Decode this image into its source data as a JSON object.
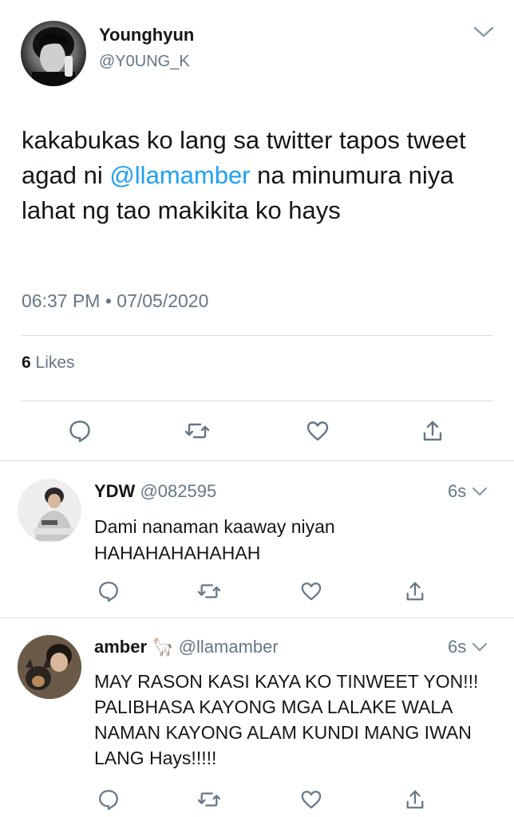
{
  "tweet": {
    "name": "Younghyun",
    "handle": "@Y0UNG_K",
    "text_before": "kakabukas ko lang sa twitter tapos tweet agad ni ",
    "mention": "@llamamber",
    "text_after": " na minumura niya lahat ng tao makikita ko hays",
    "timestamp": "06:37 PM • 07/05/2020",
    "likes_count": "6",
    "likes_label": "Likes"
  },
  "replies": [
    {
      "name": "YDW",
      "emoji": "",
      "handle": "@082595",
      "time": "6s",
      "text": "Dami nanaman kaaway niyan HAHAHAHAHAHAH"
    },
    {
      "name": "amber",
      "emoji": "🦙",
      "handle": "@llamamber",
      "time": "6s",
      "text": "MAY RASON KASI KAYA KO TINWEET YON!!! PALIBHASA KAYONG MGA LALAKE WALA NAMAN KAYONG ALAM KUNDI MANG IWAN LANG Hays!!!!!"
    }
  ],
  "icons": {
    "reply": "reply-icon",
    "retweet": "retweet-icon",
    "like": "like-heart-icon",
    "share": "share-icon",
    "caret": "chevron-down-icon"
  },
  "colors": {
    "text": "#14171a",
    "secondary": "#657786",
    "mention": "#1da1f2",
    "divider": "#d9dee2"
  }
}
